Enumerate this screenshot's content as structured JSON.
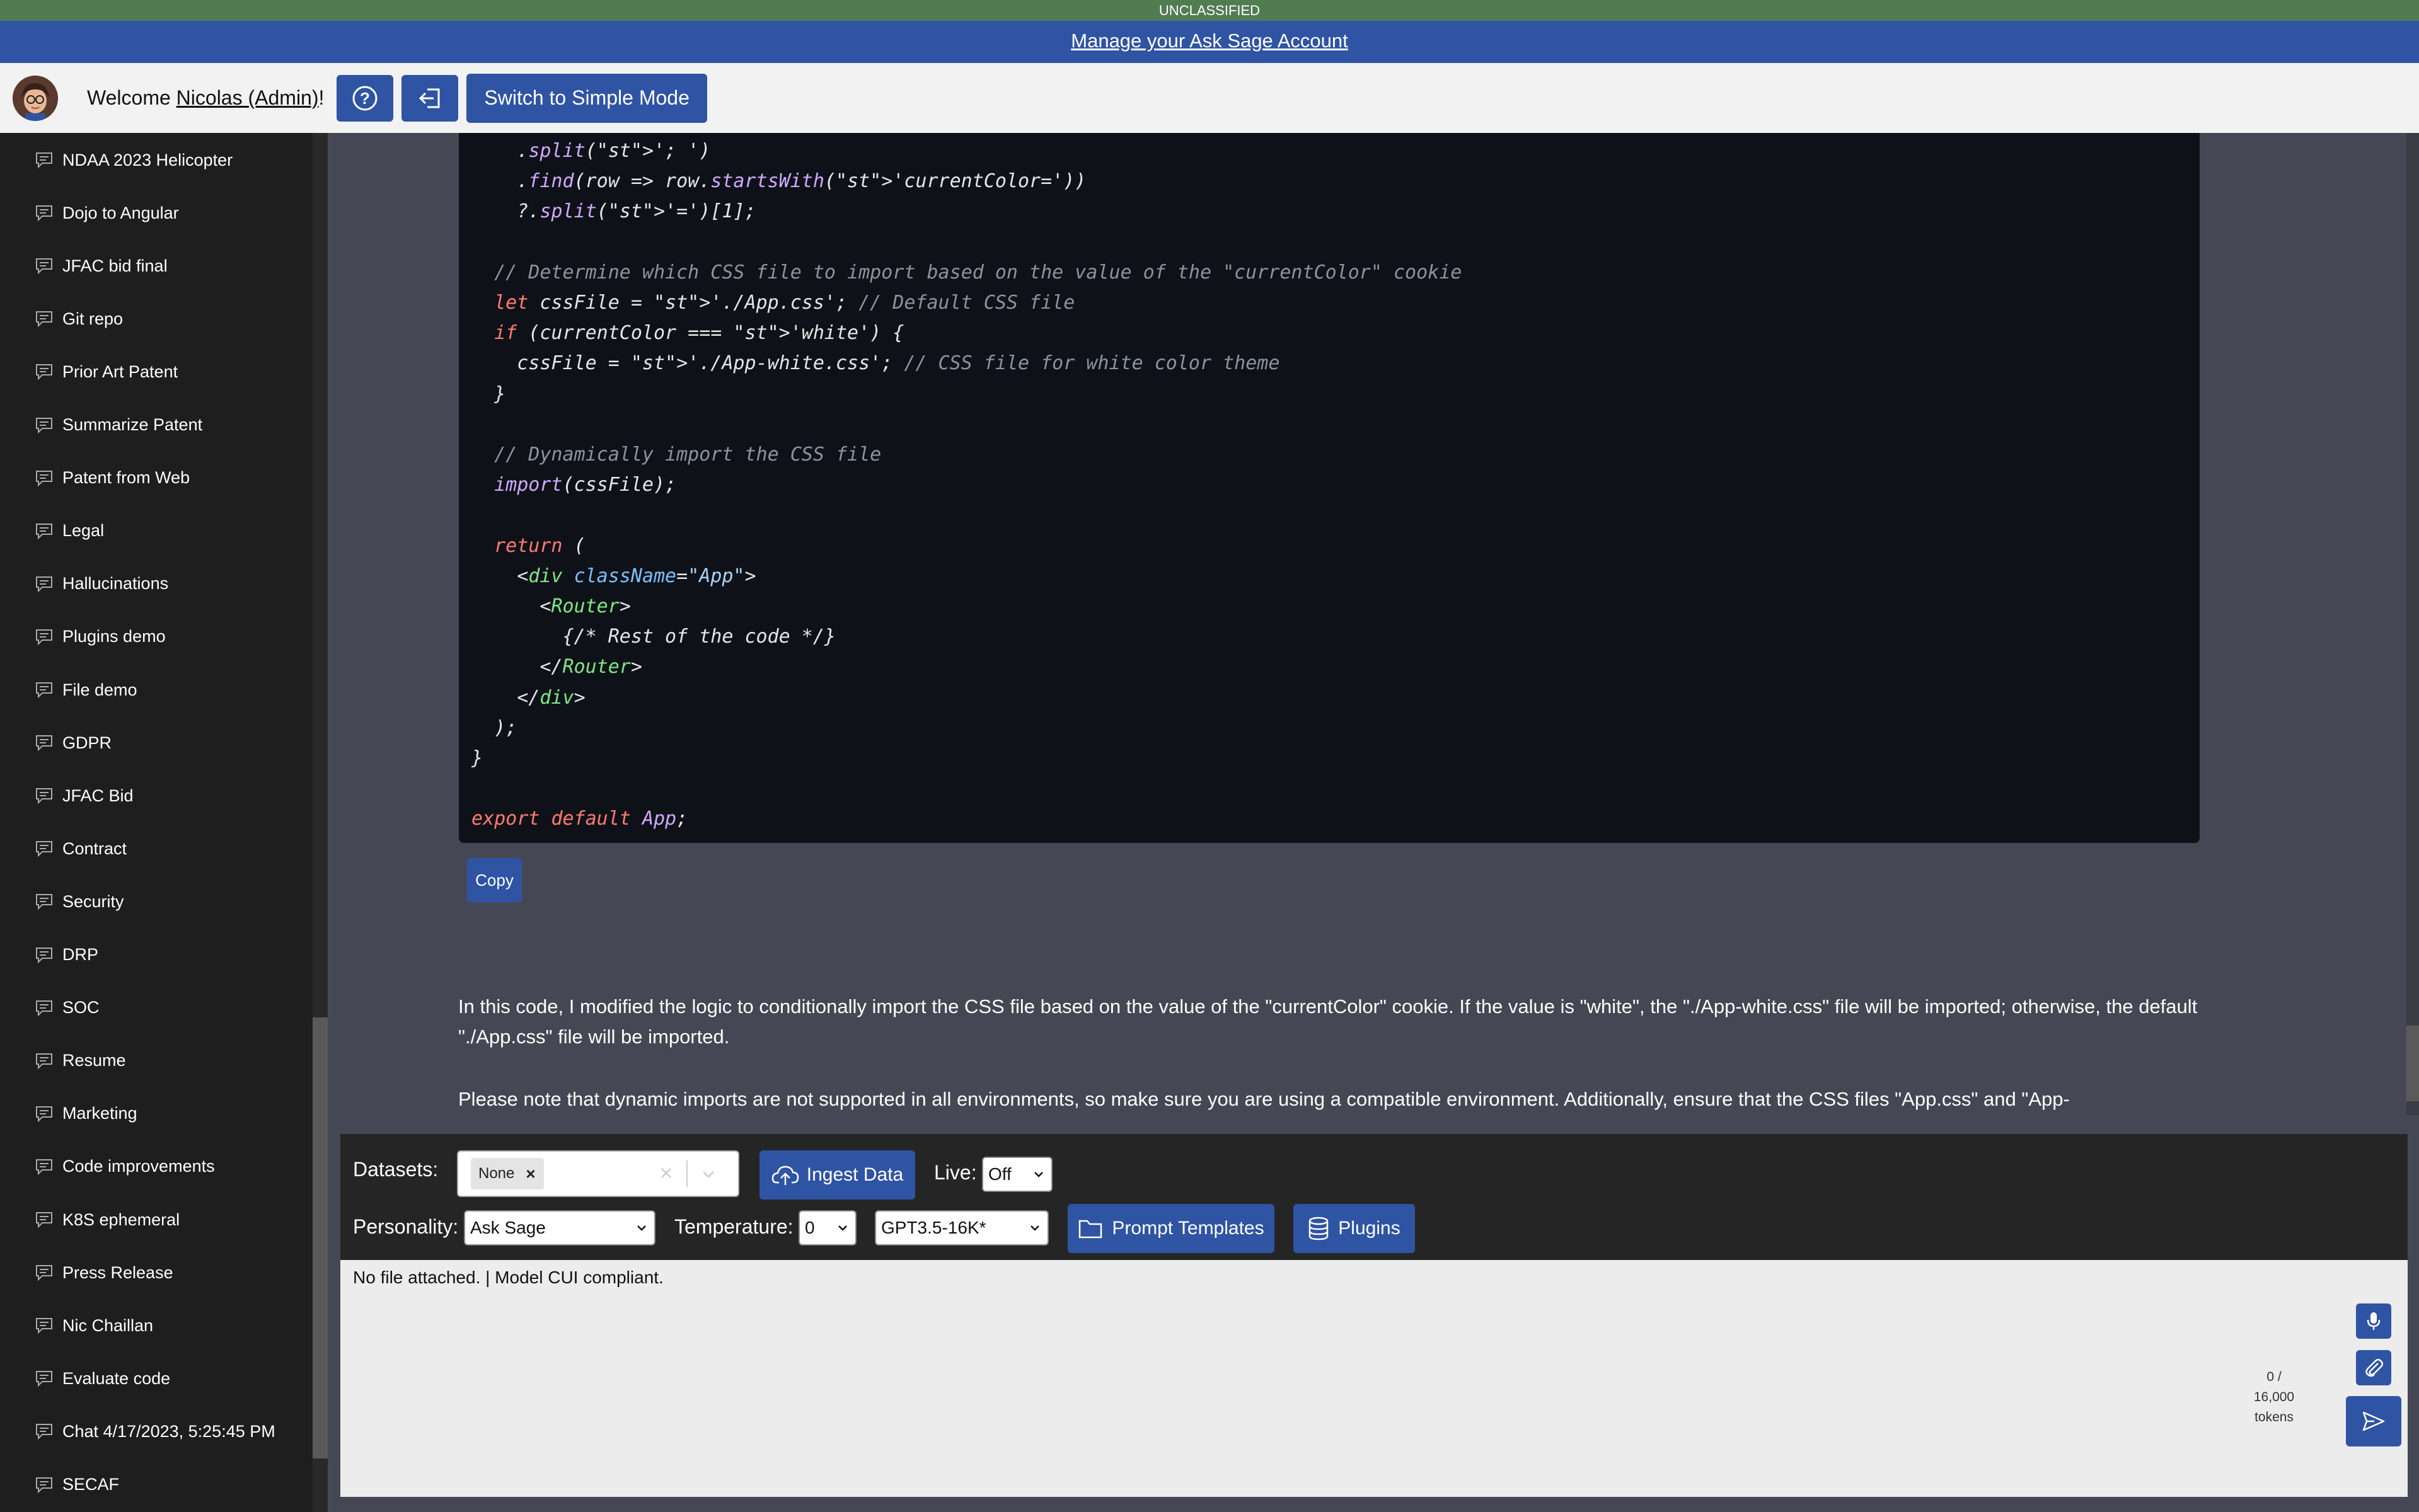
{
  "banner": {
    "classification": "UNCLASSIFIED",
    "manage_link": "Manage your Ask Sage Account"
  },
  "header": {
    "welcome_prefix": "Welcome ",
    "user_name": "Nicolas (Admin)",
    "welcome_suffix": "!",
    "help_icon": "question-circle-icon",
    "logout_icon": "logout-icon",
    "simple_mode_label": "Switch to Simple Mode"
  },
  "sidebar": {
    "item_icon": "chat-icon",
    "items": [
      {
        "label": "NDAA 2023 Helicopter"
      },
      {
        "label": "Dojo to Angular"
      },
      {
        "label": "JFAC bid final"
      },
      {
        "label": "Git repo"
      },
      {
        "label": "Prior Art Patent"
      },
      {
        "label": "Summarize Patent"
      },
      {
        "label": "Patent from Web"
      },
      {
        "label": "Legal"
      },
      {
        "label": "Hallucinations"
      },
      {
        "label": "Plugins demo"
      },
      {
        "label": "File demo"
      },
      {
        "label": "GDPR"
      },
      {
        "label": "JFAC Bid"
      },
      {
        "label": "Contract"
      },
      {
        "label": "Security"
      },
      {
        "label": "DRP"
      },
      {
        "label": "SOC"
      },
      {
        "label": "Resume"
      },
      {
        "label": "Marketing"
      },
      {
        "label": "Code improvements"
      },
      {
        "label": "K8S ephemeral"
      },
      {
        "label": "Press Release"
      },
      {
        "label": "Nic Chaillan"
      },
      {
        "label": "Evaluate code"
      },
      {
        "label": "Chat 4/17/2023, 5:25:45 PM"
      },
      {
        "label": "SECAF"
      }
    ]
  },
  "message": {
    "code_lines": [
      "    .split('; ')",
      "    .find(row => row.startsWith('currentColor='))",
      "    ?.split('=')[1];",
      "",
      "  // Determine which CSS file to import based on the value of the \"currentColor\" cookie",
      "  let cssFile = './App.css'; // Default CSS file",
      "  if (currentColor === 'white') {",
      "    cssFile = './App-white.css'; // CSS file for white color theme",
      "  }",
      "",
      "  // Dynamically import the CSS file",
      "  import(cssFile);",
      "",
      "  return (",
      "    <div className=\"App\">",
      "      <Router>",
      "        {/* Rest of the code */}",
      "      </Router>",
      "    </div>",
      "  );",
      "}",
      "",
      "export default App;"
    ],
    "copy_label": "Copy",
    "paragraph1": "In this code, I modified the logic to conditionally import the CSS file based on the value of the \"currentColor\" cookie. If the value is \"white\", the \"./App-white.css\" file will be imported; otherwise, the default \"./App.css\" file will be imported.",
    "paragraph2": "Please note that dynamic imports are not supported in all environments, so make sure you are using a compatible environment. Additionally, ensure that the CSS files \"App.css\" and \"App-"
  },
  "controls": {
    "datasets_label": "Datasets:",
    "dataset_chip": "None",
    "ingest_label": "Ingest Data",
    "live_label": "Live:",
    "live_value": "Off",
    "personality_label": "Personality:",
    "personality_value": "Ask Sage",
    "temperature_label": "Temperature:",
    "temperature_value": "0",
    "model_value": "GPT3.5-16K*",
    "prompt_templates_label": "Prompt Templates",
    "plugins_label": "Plugins"
  },
  "input": {
    "status": "No file attached. | Model CUI compliant.",
    "tokens_line1": "0 /",
    "tokens_line2": "16,000",
    "tokens_line3": "tokens",
    "mic_icon": "microphone-icon",
    "attach_icon": "paperclip-icon",
    "send_icon": "send-icon"
  },
  "colors": {
    "accent": "#2f54a4",
    "classification_green": "#517c52",
    "code_bg": "#0e1117",
    "sidebar_bg": "#1e1e1e"
  }
}
